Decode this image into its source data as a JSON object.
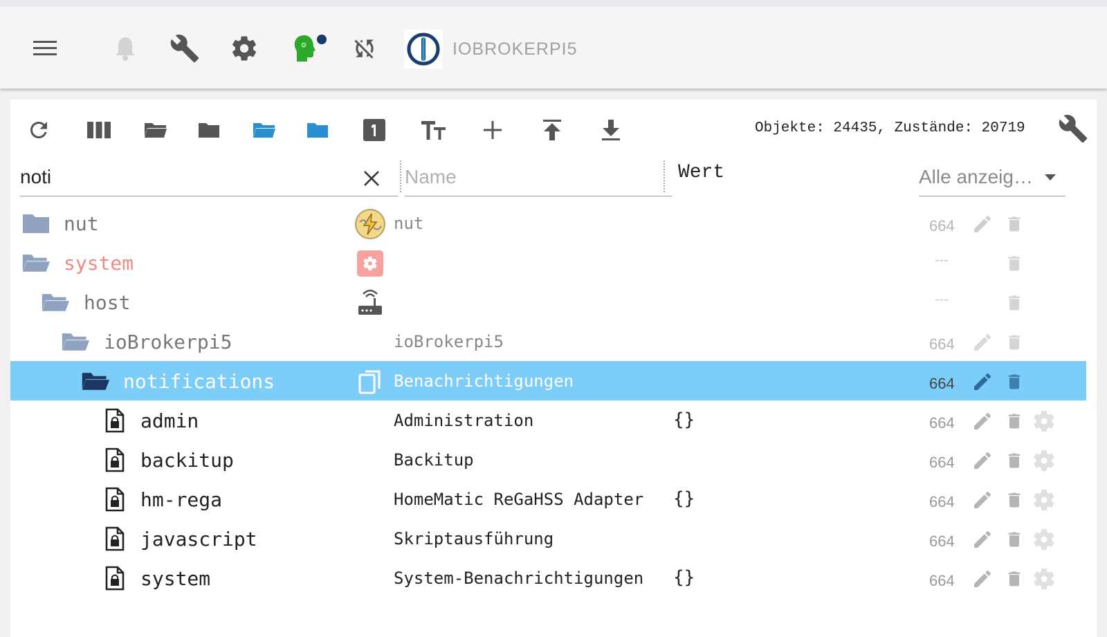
{
  "app_bar": {
    "host_name": "IOBROKERPI5",
    "icons": [
      "menu-icon",
      "bell-icon",
      "wrench-icon",
      "gear-icon",
      "head-icon",
      "sync-off-icon"
    ]
  },
  "toolbar": {
    "icons": [
      "refresh-icon",
      "columns-icon",
      "folder-open-outline-icon",
      "folder-closed-icon",
      "folder-open-blue-icon",
      "folder-closed-blue-icon",
      "one-icon",
      "text-size-icon",
      "add-icon",
      "upload-icon",
      "download-icon"
    ],
    "counts": "Objekte: 24435, Zustände: 20719"
  },
  "filters": {
    "search_value": "noti",
    "name_placeholder": "Name",
    "wert_label": "Wert",
    "select_value": "Alle anzeig…"
  },
  "colors": {
    "selected_row": "#7ccdf8",
    "folder_blue": "#8fa2c0",
    "folder_dark": "#1d3561",
    "system_red": "#f18a86"
  },
  "rows": [
    {
      "name": "nut",
      "desc": "nut",
      "value": "",
      "acl": "664"
    },
    {
      "name": "system",
      "desc": "",
      "value": "",
      "acl": "---"
    },
    {
      "name": "host",
      "desc": "",
      "value": "",
      "acl": "---"
    },
    {
      "name": "ioBrokerpi5",
      "desc": "ioBrokerpi5",
      "value": "",
      "acl": "664"
    },
    {
      "name": "notifications",
      "desc": "Benachrichtigungen",
      "value": "",
      "acl": "664"
    },
    {
      "name": "admin",
      "desc": "Administration",
      "value": "{}",
      "acl": "664"
    },
    {
      "name": "backitup",
      "desc": "Backitup",
      "value": "",
      "acl": "664"
    },
    {
      "name": "hm-rega",
      "desc": "HomeMatic ReGaHSS Adapter",
      "value": "{}",
      "acl": "664"
    },
    {
      "name": "javascript",
      "desc": "Skriptausführung",
      "value": "",
      "acl": "664"
    },
    {
      "name": "system",
      "desc": "System-Benachrichtigungen",
      "value": "{}",
      "acl": "664"
    }
  ]
}
